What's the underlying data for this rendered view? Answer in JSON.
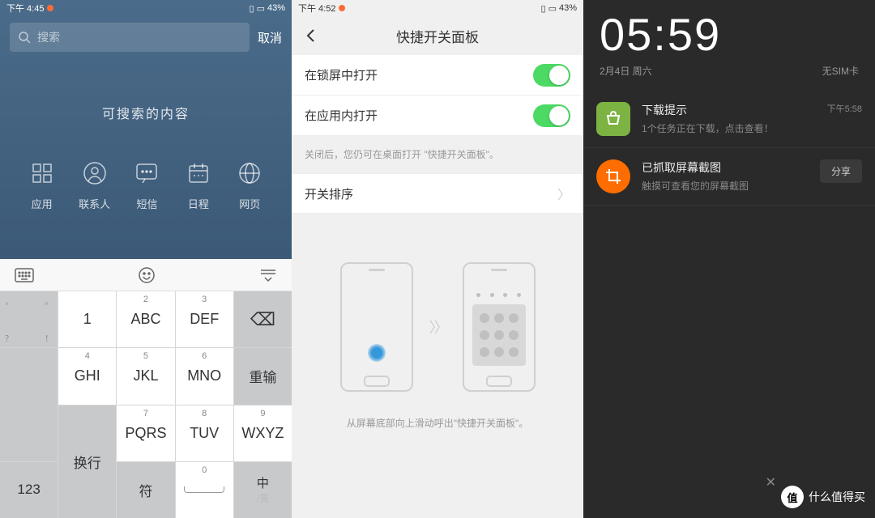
{
  "pane1": {
    "status": {
      "time": "下午 4:45",
      "battery": "43%"
    },
    "search": {
      "placeholder": "搜索",
      "cancel": "取消"
    },
    "heading": "可搜索的内容",
    "icons": [
      {
        "label": "应用",
        "name": "apps-icon"
      },
      {
        "label": "联系人",
        "name": "contacts-icon"
      },
      {
        "label": "短信",
        "name": "messages-icon"
      },
      {
        "label": "日程",
        "name": "calendar-icon"
      },
      {
        "label": "网页",
        "name": "web-icon"
      }
    ],
    "keys": {
      "r1": [
        "1",
        "ABC",
        "DEF"
      ],
      "r1n": [
        "",
        "2",
        "3"
      ],
      "r2": [
        "GHI",
        "JKL",
        "MNO"
      ],
      "r2n": [
        "4",
        "5",
        "6"
      ],
      "r3": [
        "PQRS",
        "TUV",
        "WXYZ"
      ],
      "r3n": [
        "7",
        "8",
        "9"
      ],
      "side": {
        "delete": "⌫",
        "retype": "重输",
        "newline": "换行"
      },
      "bottom": {
        "num": "123",
        "sym": "符",
        "space": "0",
        "zh": "中",
        "en": "/英"
      },
      "punct": [
        "，",
        "。",
        "？",
        "！"
      ]
    }
  },
  "pane2": {
    "status": {
      "time": "下午 4:52",
      "battery": "43%"
    },
    "title": "快捷开关面板",
    "rows": [
      {
        "label": "在锁屏中打开",
        "toggle": true
      },
      {
        "label": "在应用内打开",
        "toggle": true
      }
    ],
    "hint": "关闭后，您仍可在桌面打开 \"快捷开关面板\"。",
    "order": "开关排序",
    "caption": "从屏幕底部向上滑动呼出\"快捷开关面板\"。"
  },
  "pane3": {
    "clock": "05:59",
    "date": "2月4日  周六",
    "sim": "无SIM卡",
    "notifs": [
      {
        "title": "下载提示",
        "sub": "1个任务正在下载，点击查看！",
        "time": "下午5:58",
        "icon": "green"
      },
      {
        "title": "已抓取屏幕截图",
        "sub": "触摸可查看您的屏幕截图",
        "btn": "分享",
        "icon": "orange"
      }
    ],
    "watermark": "什么值得买",
    "wm_badge": "值"
  }
}
